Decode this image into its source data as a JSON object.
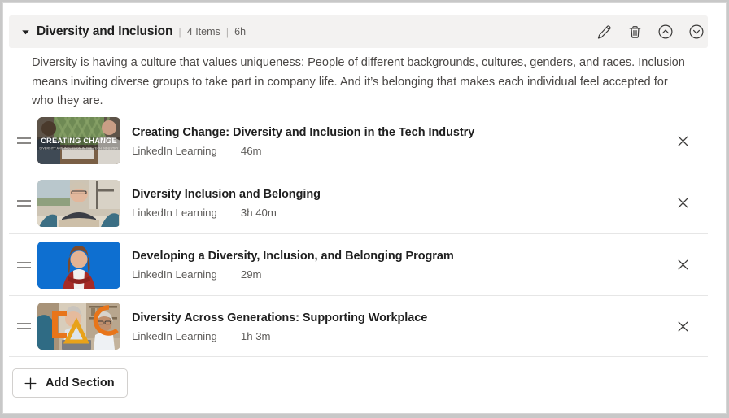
{
  "section": {
    "title": "Diversity and Inclusion",
    "item_count_label": "4 Items",
    "duration_label": "6h",
    "separator": "|",
    "description": "Diversity is having a culture that values uniqueness: People of different backgrounds, cultures, genders, and races. Inclusion means inviting diverse groups to take part in company life. And it’s belonging that makes each individual feel accepted for who they are.",
    "collapse_icon": "caret-down-icon",
    "actions": [
      {
        "name": "edit-section-button",
        "icon": "pencil-icon",
        "label": "Edit"
      },
      {
        "name": "delete-section-button",
        "icon": "trash-icon",
        "label": "Delete"
      },
      {
        "name": "move-section-up-button",
        "icon": "chevron-up-circle-icon",
        "label": "Move up"
      },
      {
        "name": "move-section-down-button",
        "icon": "chevron-down-circle-icon",
        "label": "Move down"
      }
    ]
  },
  "items": [
    {
      "title": "Creating Change: Diversity and Inclusion in the Tech Industry",
      "provider": "LinkedIn Learning",
      "duration": "46m",
      "thumbnail": {
        "style": "photo-office-laptop",
        "overlay_title": "CREATING CHANGE",
        "overlay_subtitle": "DIVERSITY AND INCLUSION IN THE TECH INDUSTRY",
        "base_color": "#6f6558",
        "accent_color": "#8fa06d"
      },
      "remove_icon": "close-icon"
    },
    {
      "title": "Diversity Inclusion and Belonging",
      "provider": "LinkedIn Learning",
      "duration": "3h 40m",
      "thumbnail": {
        "style": "photo-woman-desk",
        "overlay_title": "",
        "overlay_subtitle": "",
        "base_color": "#cfc5b4",
        "accent_color": "#4a7f93"
      },
      "remove_icon": "close-icon"
    },
    {
      "title": "Developing a Diversity, Inclusion, and Belonging Program",
      "provider": "LinkedIn Learning",
      "duration": "29m",
      "thumbnail": {
        "style": "photo-woman-red-blazer-blue-bg",
        "overlay_title": "",
        "overlay_subtitle": "",
        "base_color": "#0a66c2",
        "accent_color": "#a32b26"
      },
      "remove_icon": "close-icon"
    },
    {
      "title": "Diversity Across Generations: Supporting Workplace",
      "provider": "LinkedIn Learning",
      "duration": "1h 3m",
      "thumbnail": {
        "style": "photo-two-women-shapes",
        "overlay_title": "",
        "overlay_subtitle": "",
        "base_color": "#b7a894",
        "accent_color": "#e8751a"
      },
      "remove_icon": "close-icon"
    }
  ],
  "footer": {
    "add_section_label": "Add Section",
    "add_section_icon": "plus-icon"
  },
  "colors": {
    "header_band": "#f3f2f1",
    "card_background": "#ffffff",
    "frame": "#c8c8c8",
    "divider": "#e6e6e6",
    "title_text": "#1f1f1f",
    "muted_text": "#605e5c"
  }
}
